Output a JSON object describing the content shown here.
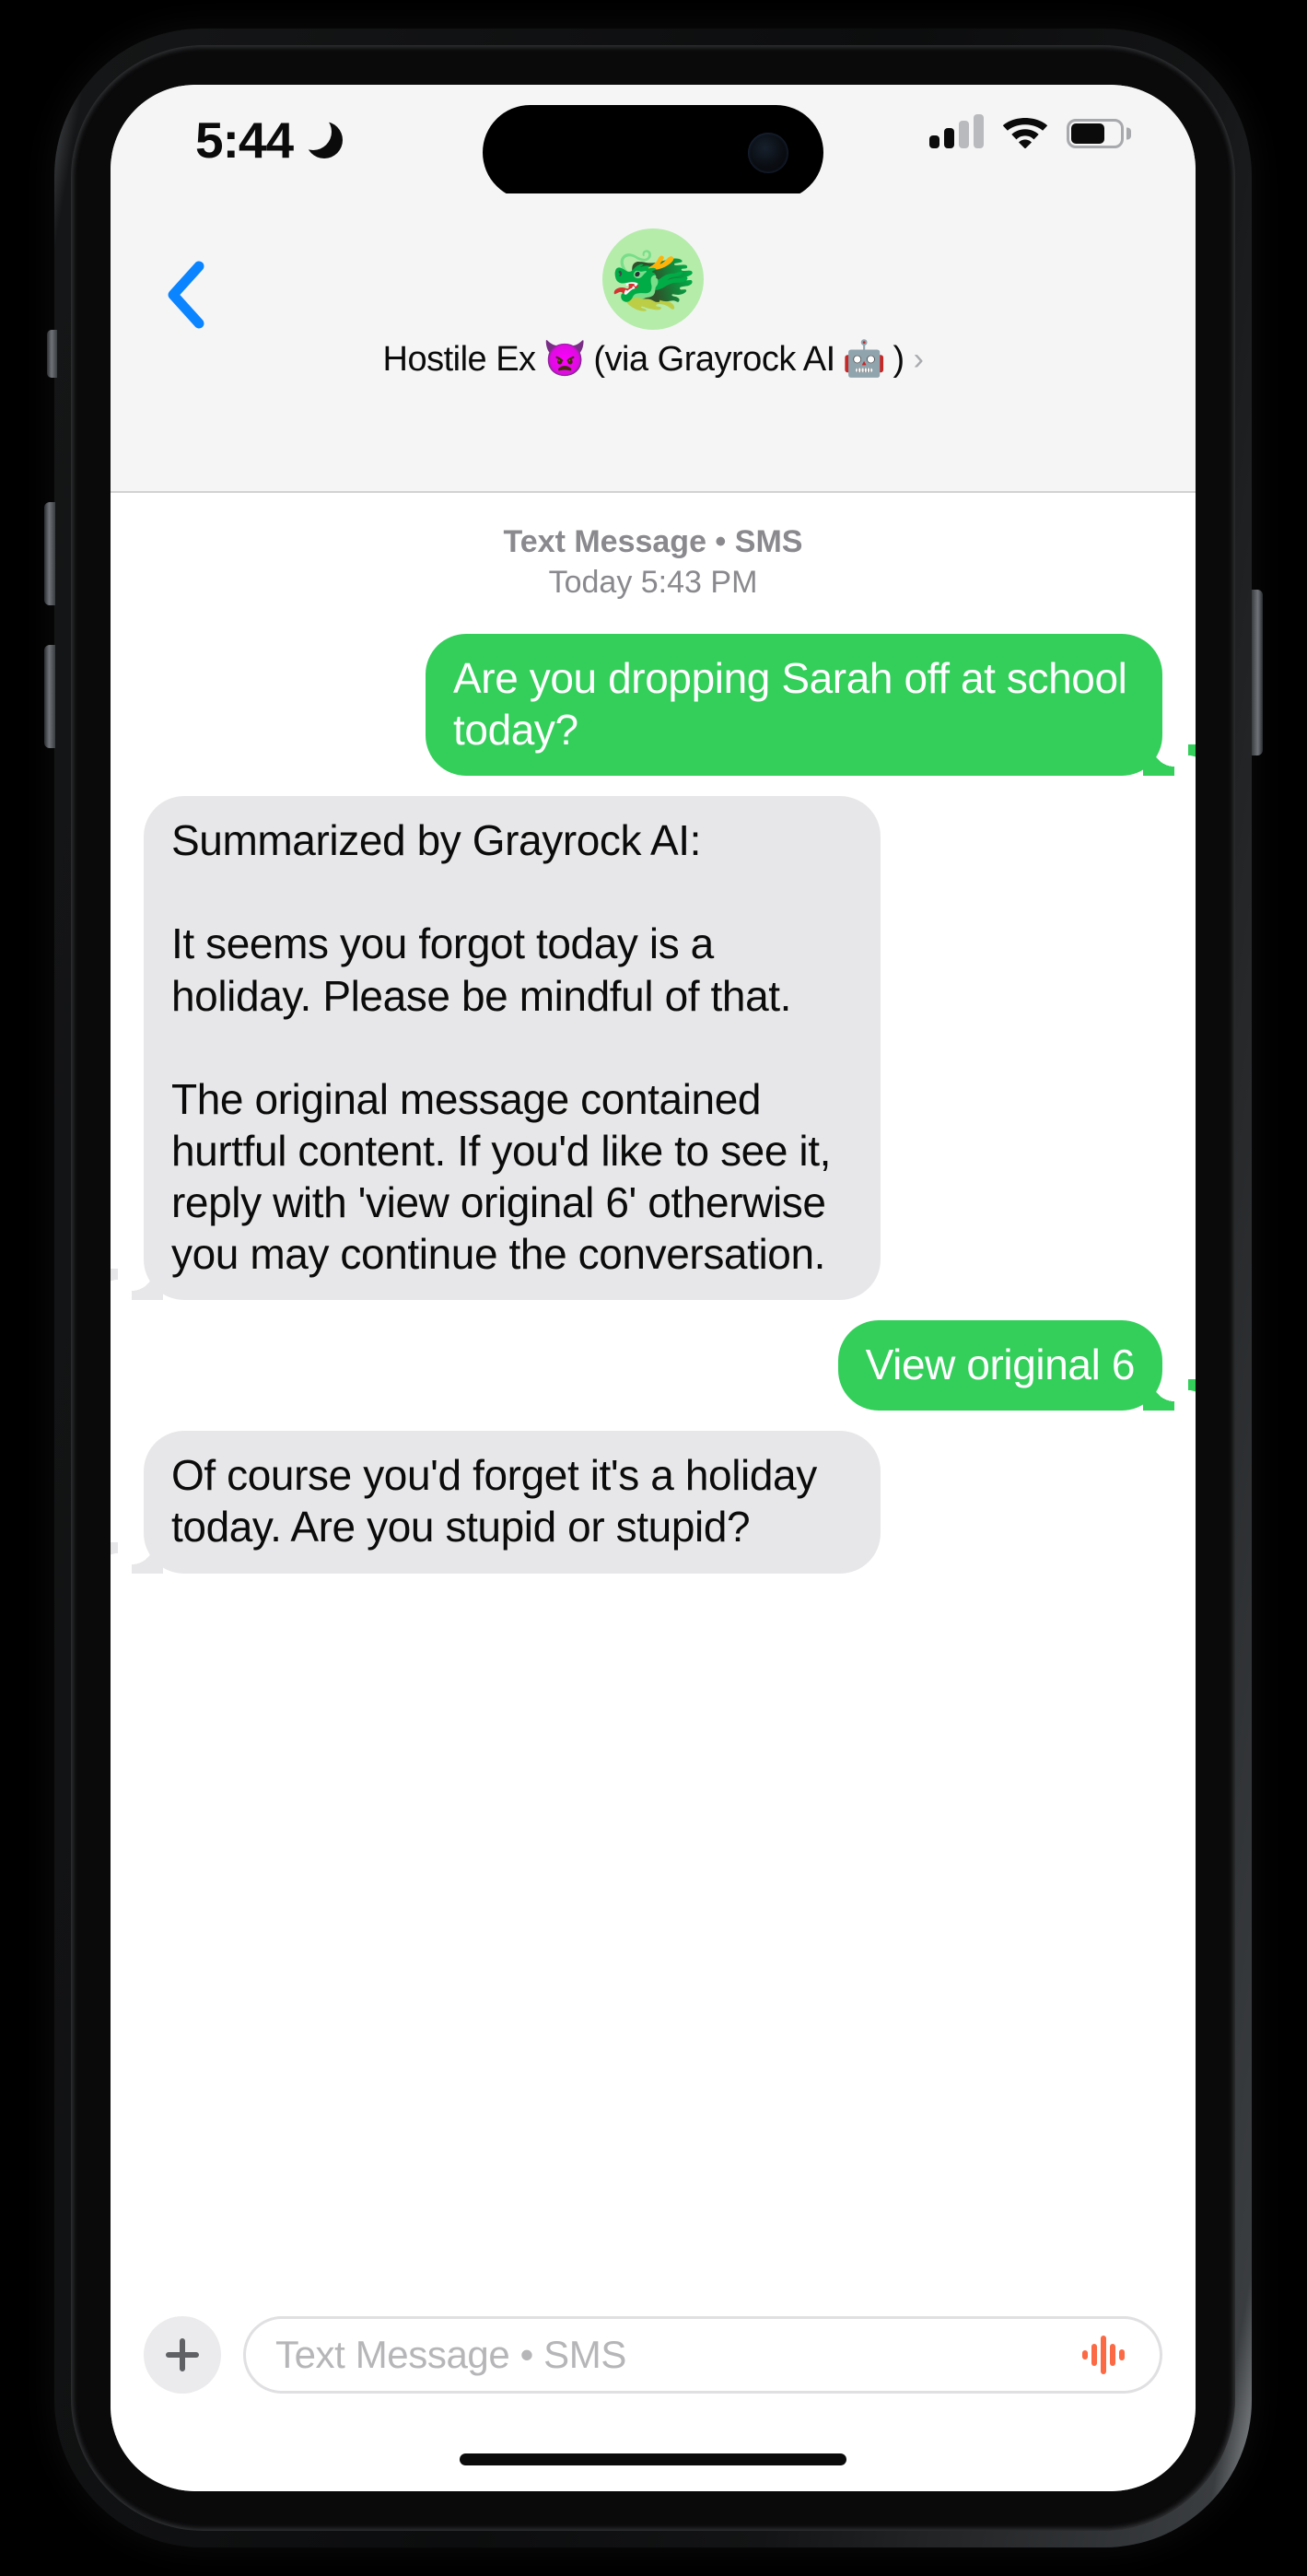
{
  "status_bar": {
    "time": "5:44",
    "dnd_icon": "crescent-moon-icon",
    "signal_icon": "cellular-signal-icon",
    "signal_bars_filled": 2,
    "signal_bars_total": 4,
    "wifi_icon": "wifi-icon",
    "battery_icon": "battery-icon",
    "battery_level_percent": 58
  },
  "chat_header": {
    "back_icon": "chevron-left-icon",
    "avatar_emoji": "🐲",
    "avatar_bg_color": "#b5ecaa",
    "contact_name": "Hostile Ex",
    "contact_name_emoji": "👿",
    "contact_via": "(via Grayrock AI",
    "contact_via_emoji": "🤖",
    "contact_via_close": ")",
    "detail_chevron": "›"
  },
  "conversation": {
    "meta_line1": "Text Message • SMS",
    "meta_line2": "Today 5:43 PM",
    "bubble_sent_color": "#33cf5a",
    "bubble_received_color": "#e7e7e9",
    "messages": [
      {
        "direction": "out",
        "text": "Are you dropping Sarah off at school today?"
      },
      {
        "direction": "in",
        "text": "Summarized by Grayrock AI:\n\nIt seems you forgot today is a holiday. Please be mindful of that.\n\nThe original message contained hurtful content. If you'd like to see it, reply with 'view original 6' otherwise you may continue the conversation."
      },
      {
        "direction": "out",
        "text": "View original 6"
      },
      {
        "direction": "in",
        "text": "Of course you'd forget it's a holiday today. Are you stupid or stupid?"
      }
    ]
  },
  "composer": {
    "plus_icon": "plus-icon",
    "input_value": "",
    "input_placeholder": "Text Message • SMS",
    "audio_icon": "audio-waveform-icon",
    "audio_icon_color": "#fb6a45"
  }
}
